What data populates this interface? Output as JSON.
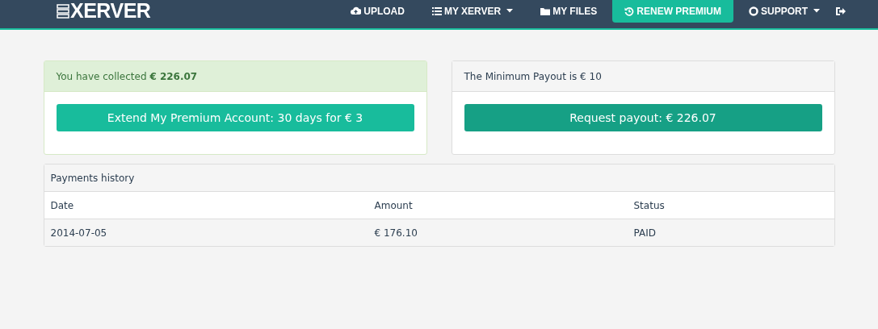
{
  "header": {
    "logo": "XERVER",
    "nav": [
      {
        "label": "UPLOAD",
        "dropdown": false,
        "selected": false
      },
      {
        "label": "MY XERVER",
        "dropdown": true,
        "selected": false
      },
      {
        "label": "MY FILES",
        "dropdown": false,
        "selected": false
      },
      {
        "label": "RENEW PREMIUM",
        "dropdown": false,
        "selected": true
      },
      {
        "label": "SUPPORT",
        "dropdown": true,
        "selected": false
      }
    ]
  },
  "collected_panel": {
    "heading": "You have collected **€ 226.07**",
    "button": "Extend My Premium Account: 30 days for € 3"
  },
  "payout_panel": {
    "heading": "The Minimum Payout is € 10",
    "button": "Request payout: € 226.07"
  },
  "payments": {
    "title": "Payments history",
    "columns": [
      "Date",
      "Amount",
      "Status"
    ],
    "rows": [
      [
        "2014-07-05",
        "€ 176.10",
        "PAID"
      ]
    ]
  }
}
